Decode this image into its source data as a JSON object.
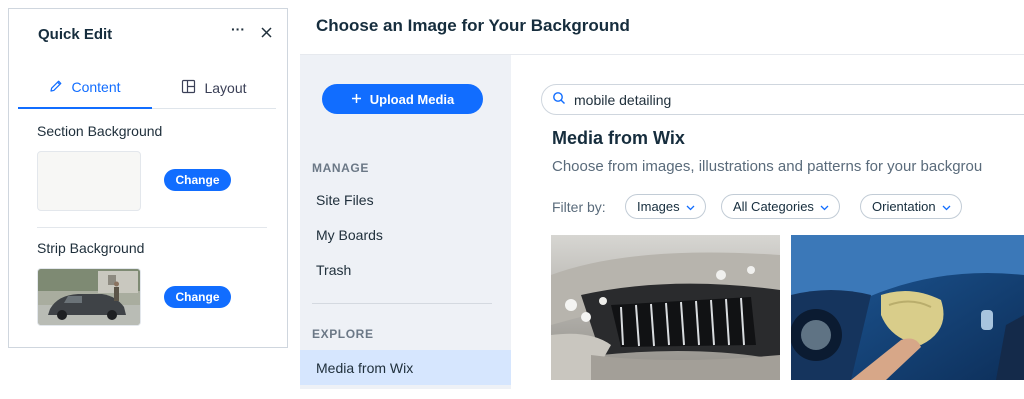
{
  "quick_edit": {
    "title": "Quick Edit",
    "more_icon": "···",
    "tabs": [
      {
        "label": "Content",
        "icon": "pencil-icon",
        "active": true
      },
      {
        "label": "Layout",
        "icon": "layout-icon",
        "active": false
      }
    ],
    "sections": [
      {
        "label": "Section Background",
        "thumbnail": "blank",
        "button": "Change"
      },
      {
        "label": "Strip Background",
        "thumbnail": "car-photo",
        "button": "Change"
      }
    ]
  },
  "dialog": {
    "title": "Choose an Image for Your Background",
    "upload_button": "Upload Media",
    "sidebar": {
      "manage_heading": "MANAGE",
      "manage_items": [
        "Site Files",
        "My Boards",
        "Trash"
      ],
      "explore_heading": "EXPLORE",
      "explore_items": [
        {
          "label": "Media from Wix",
          "active": true
        }
      ]
    },
    "search": {
      "value": "mobile detailing",
      "icon": "search-icon"
    },
    "heading": "Media from Wix",
    "subheading": "Choose from images, illustrations and patterns for your backgrou",
    "filter": {
      "label": "Filter by:",
      "chips": [
        "Images",
        "All Categories",
        "Orientation"
      ]
    },
    "images": [
      "car-foam-wash-photo",
      "car-polishing-cloth-photo"
    ]
  },
  "colors": {
    "accent": "#116dff",
    "sidebar_bg": "#eef1f6",
    "active_item": "#d6e6fe"
  }
}
